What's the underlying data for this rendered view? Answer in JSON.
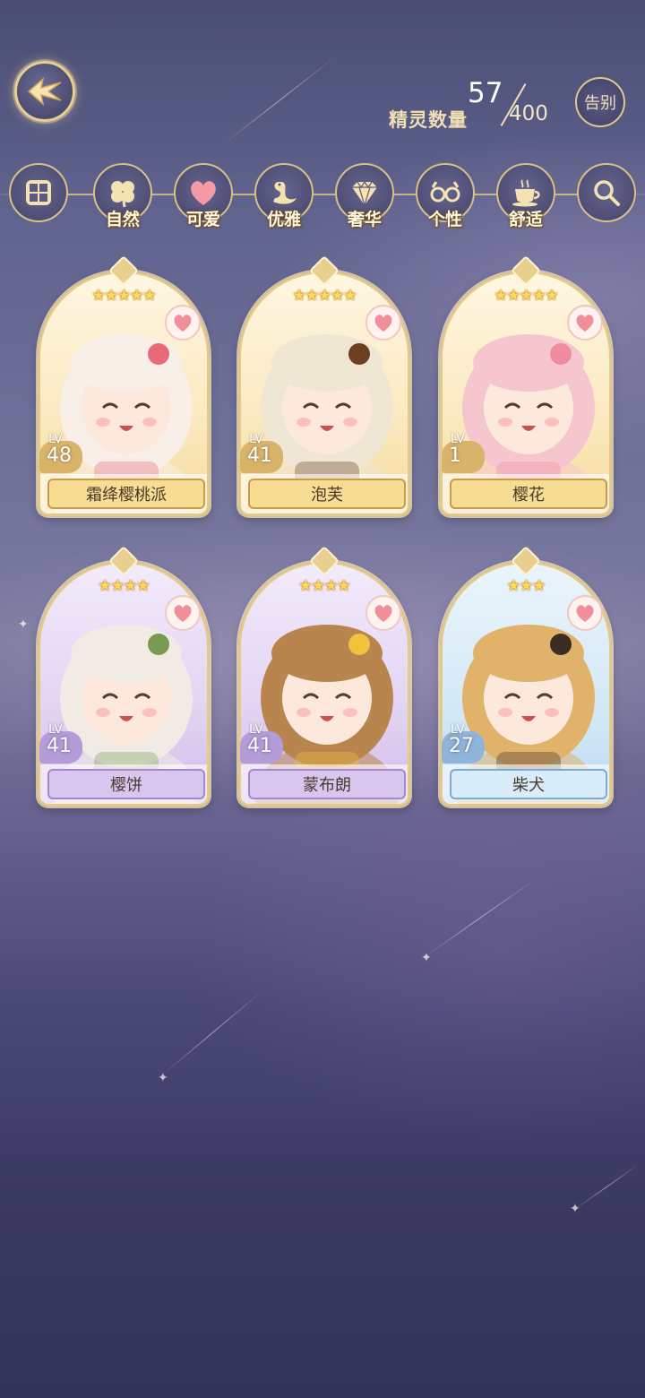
{
  "header": {
    "count_label": "精灵数量",
    "count_current": "57",
    "count_total": "400",
    "farewell_label": "告别"
  },
  "filters": [
    {
      "id": "all",
      "label": "",
      "icon": "grid-icon"
    },
    {
      "id": "nature",
      "label": "自然",
      "icon": "clover-icon"
    },
    {
      "id": "cute",
      "label": "可爱",
      "icon": "heart-icon"
    },
    {
      "id": "elegant",
      "label": "优雅",
      "icon": "swan-icon"
    },
    {
      "id": "luxury",
      "label": "奢华",
      "icon": "diamond-icon"
    },
    {
      "id": "personality",
      "label": "个性",
      "icon": "glasses-icon"
    },
    {
      "id": "comfort",
      "label": "舒适",
      "icon": "teacup-icon"
    },
    {
      "id": "search",
      "label": "",
      "icon": "search-icon"
    }
  ],
  "sprites": [
    {
      "name": "霜绛樱桃派",
      "level_prefix": "LV",
      "level": "48",
      "stars": "★★★★★",
      "rarity": "gold",
      "hair": "#f7efe8",
      "accent": "#e86a7a"
    },
    {
      "name": "泡芙",
      "level_prefix": "LV",
      "level": "41",
      "stars": "★★★★★",
      "rarity": "gold",
      "hair": "#efe6d4",
      "accent": "#6b3f1f"
    },
    {
      "name": "樱花",
      "level_prefix": "LV",
      "level": "1",
      "stars": "★★★★★",
      "rarity": "gold",
      "hair": "#f6c6cf",
      "accent": "#f08ca0"
    },
    {
      "name": "樱饼",
      "level_prefix": "LV",
      "level": "41",
      "stars": "★★★★",
      "rarity": "purple",
      "hair": "#f1ebe6",
      "accent": "#7a9a52"
    },
    {
      "name": "蒙布朗",
      "level_prefix": "LV",
      "level": "41",
      "stars": "★★★★",
      "rarity": "purple",
      "hair": "#b9854f",
      "accent": "#f2c23e"
    },
    {
      "name": "柴犬",
      "level_prefix": "LV",
      "level": "27",
      "stars": "★★★",
      "rarity": "blue",
      "hair": "#e0b26a",
      "accent": "#3c2d22"
    }
  ],
  "colors": {
    "gold_bg_top": "#fff3d6",
    "gold_plate": "#f7dc94",
    "purple_bg_top": "#e9ddf5",
    "purple_plate": "#d7c3ee",
    "blue_bg_top": "#d8ebf8",
    "blue_plate": "#d6ecf9",
    "frame": "#e3c98a"
  }
}
